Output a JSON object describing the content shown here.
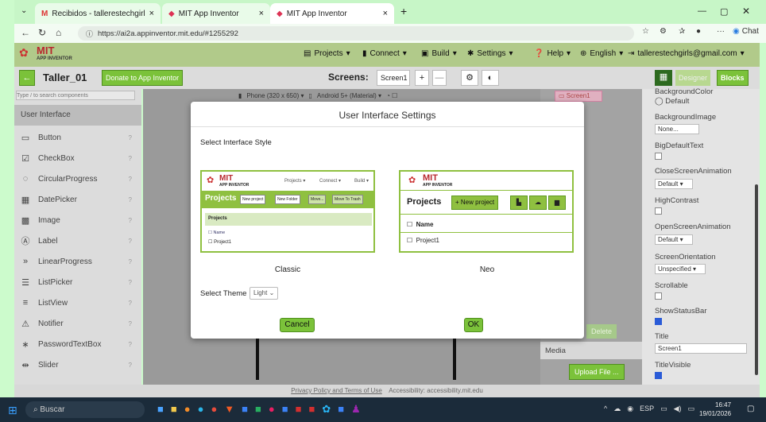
{
  "browser": {
    "tabs": [
      {
        "title": "Recibidos - tallerestechgirls@gmail...",
        "icon": "gmail-icon"
      },
      {
        "title": "MIT App Inventor",
        "icon": "app-inventor-icon"
      },
      {
        "title": "MIT App Inventor",
        "icon": "app-inventor-icon"
      }
    ],
    "url": "https://ai2a.appinventor.mit.edu/#1255292",
    "chat_label": "Chat"
  },
  "app": {
    "logo_top": "MIT",
    "logo_bottom": "APP INVENTOR",
    "menu": [
      "Projects",
      "Connect",
      "Build",
      "Settings",
      "Help",
      "English"
    ],
    "account": "tallerestechgirls@gmail.com",
    "project_name": "Taller_01",
    "donate": "Donate to App Inventor",
    "screens_label": "Screens:",
    "screen_select": "Screen1",
    "add_screen": "+",
    "remove_screen": "—",
    "designer": "Designer",
    "blocks": "Blocks"
  },
  "palette": {
    "search_placeholder": "Type / to search components",
    "category": "User Interface",
    "items": [
      {
        "label": "Button",
        "icon": "button-icon"
      },
      {
        "label": "CheckBox",
        "icon": "checkbox-icon"
      },
      {
        "label": "CircularProgress",
        "icon": "circular-progress-icon"
      },
      {
        "label": "DatePicker",
        "icon": "calendar-icon"
      },
      {
        "label": "Image",
        "icon": "image-icon"
      },
      {
        "label": "Label",
        "icon": "label-icon"
      },
      {
        "label": "LinearProgress",
        "icon": "linear-progress-icon"
      },
      {
        "label": "ListPicker",
        "icon": "list-icon"
      },
      {
        "label": "ListView",
        "icon": "listview-icon"
      },
      {
        "label": "Notifier",
        "icon": "warning-icon"
      },
      {
        "label": "PasswordTextBox",
        "icon": "password-icon"
      },
      {
        "label": "Slider",
        "icon": "slider-icon"
      }
    ]
  },
  "viewer": {
    "device": "Phone (320 x 650)",
    "theme": "Android 5+ (Material)"
  },
  "tree": {
    "screen": "Screen1",
    "delete": "Delete",
    "media": "Media",
    "upload": "Upload File ..."
  },
  "properties": {
    "bg_color_label": "BackgroundColor",
    "bg_color_value": "Default",
    "bg_image_label": "BackgroundImage",
    "bg_image_value": "None...",
    "big_default_text": "BigDefaultText",
    "close_anim_label": "CloseScreenAnimation",
    "close_anim_value": "Default",
    "high_contrast": "HighContrast",
    "open_anim_label": "OpenScreenAnimation",
    "open_anim_value": "Default",
    "orientation_label": "ScreenOrientation",
    "orientation_value": "Unspecified",
    "scrollable": "Scrollable",
    "show_status_bar": "ShowStatusBar",
    "title_label": "Title",
    "title_value": "Screen1",
    "title_visible": "TitleVisible"
  },
  "modal": {
    "title": "User Interface Settings",
    "select_style": "Select Interface Style",
    "classic": {
      "label": "Classic",
      "menu": [
        "Projects",
        "Connect",
        "Build"
      ],
      "heading": "Projects",
      "buttons": [
        "New project",
        "New Folder",
        "Move...",
        "Move To Trash"
      ],
      "subheading": "Projects",
      "col_name": "Name",
      "row": "Project1"
    },
    "neo": {
      "label": "Neo",
      "heading": "Projects",
      "new_project": "+ New project",
      "col_name": "Name",
      "row": "Project1"
    },
    "select_theme": "Select Theme",
    "theme_value": "Light",
    "cancel": "Cancel",
    "ok": "OK"
  },
  "footer": {
    "privacy": "Privacy Policy and Terms of Use",
    "accessibility": "Accessibility: accessibility.mit.edu"
  },
  "taskbar": {
    "search": "Buscar",
    "lang": "ESP",
    "time": "16:47",
    "date": "19/01/2026"
  },
  "colors": {
    "accent": "#7bc23a",
    "toolbar": "#b1ca8a",
    "window_bg": "#ccfbcc"
  }
}
